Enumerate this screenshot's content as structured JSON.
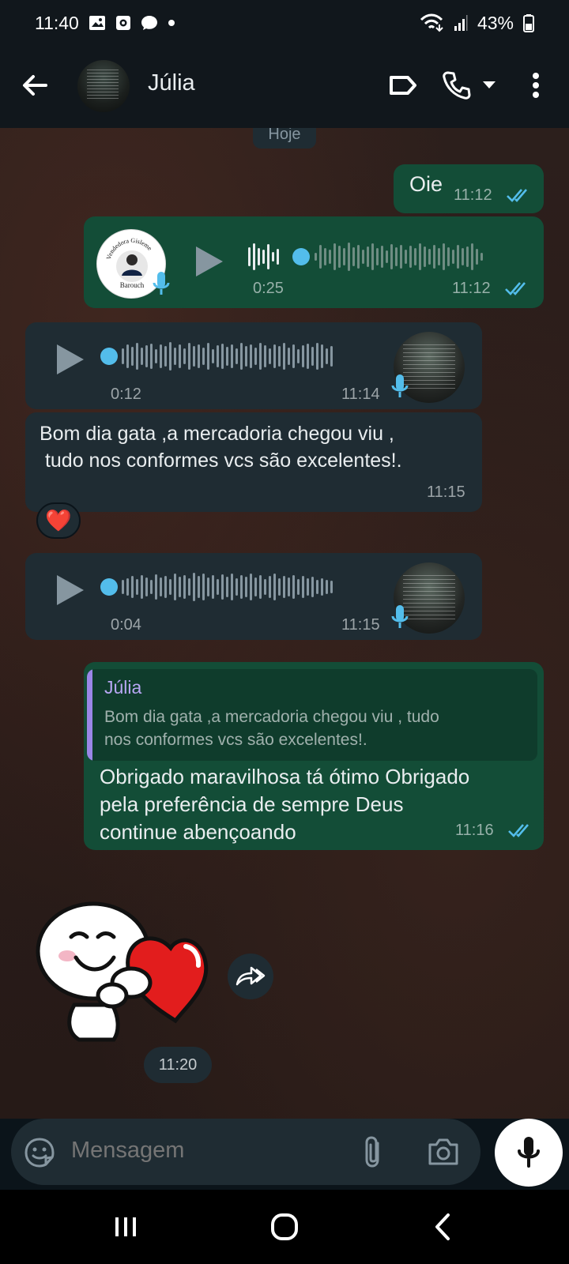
{
  "status": {
    "time": "11:40",
    "battery": "43%",
    "icons": [
      "image-icon",
      "camera-app-icon",
      "chat-bubble-icon",
      "notification-dot-icon",
      "wifi-icon",
      "signal-icon",
      "battery-icon"
    ]
  },
  "header": {
    "contact_name": "Júlia",
    "icons": [
      "back-arrow-icon",
      "label-icon",
      "phone-icon",
      "dropdown-icon",
      "more-options-icon"
    ]
  },
  "chat": {
    "date": "Hoje",
    "messages": [
      {
        "type": "text",
        "direction": "out",
        "text": "Oie",
        "time": "11:12",
        "status": "read"
      },
      {
        "type": "voice",
        "direction": "out",
        "duration": "0:25",
        "time": "11:12",
        "status": "read",
        "avatar_text": [
          "Vendedora Gisleme",
          "Barouch"
        ]
      },
      {
        "type": "voice",
        "direction": "in",
        "duration": "0:12",
        "time": "11:14"
      },
      {
        "type": "text",
        "direction": "in",
        "text_line1": "Bom dia gata ,a mercadoria chegou viu ,",
        "text_line2": " tudo nos conformes vcs são excelentes!.",
        "time": "11:15",
        "reaction": "❤️"
      },
      {
        "type": "voice",
        "direction": "in",
        "duration": "0:04",
        "time": "11:15"
      },
      {
        "type": "reply",
        "direction": "out",
        "quoted_name": "Júlia",
        "quoted_text_line1": "Bom dia gata ,a mercadoria chegou viu , tudo",
        "quoted_text_line2": "nos conformes vcs são excelentes!.",
        "text_line1": "Obrigado maravilhosa tá ótimo Obrigado",
        "text_line2": "pela preferência de sempre Deus",
        "text_line3": "continue abençoando",
        "time": "11:16",
        "status": "read"
      },
      {
        "type": "sticker",
        "direction": "in",
        "description": "hugging-heart-sticker",
        "time": "11:20"
      }
    ]
  },
  "composer": {
    "placeholder": "Mensagem",
    "icons": [
      "sticker-icon",
      "attach-icon",
      "camera-icon",
      "microphone-icon"
    ]
  },
  "colors": {
    "outgoing_bubble": "#134d37",
    "incoming_bubble": "#1f2c33",
    "accent_blue": "#53bdeb",
    "quote_bar": "#9b86e7"
  }
}
